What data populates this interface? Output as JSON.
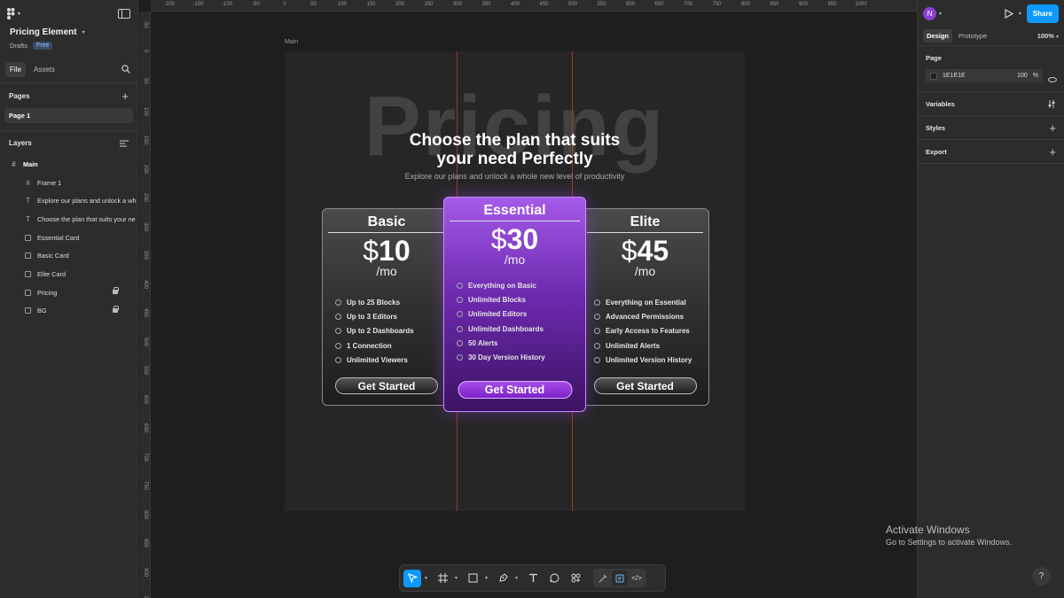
{
  "file": {
    "name": "Pricing Element",
    "location": "Drafts",
    "plan_badge": "Free"
  },
  "left_tabs": [
    "File",
    "Assets"
  ],
  "pages": {
    "title": "Pages",
    "items": [
      "Page 1"
    ]
  },
  "layers": {
    "title": "Layers",
    "items": [
      {
        "name": "Main",
        "icon": "frame-icon",
        "level": 0
      },
      {
        "name": "Frame 1",
        "icon": "frame-icon",
        "level": 1
      },
      {
        "name": "Explore our plans and unlock a wh",
        "icon": "text-icon",
        "level": 1
      },
      {
        "name": "Choose the plan that suits your ne",
        "icon": "text-icon",
        "level": 1
      },
      {
        "name": "Essential Card",
        "icon": "rect-icon",
        "level": 1
      },
      {
        "name": "Basic Card",
        "icon": "rect-icon",
        "level": 1
      },
      {
        "name": "Elite Card",
        "icon": "rect-icon",
        "level": 1
      },
      {
        "name": "Pricing",
        "icon": "rect-icon",
        "level": 1,
        "locked": true
      },
      {
        "name": "BG",
        "icon": "rect-icon",
        "level": 1,
        "locked": true
      }
    ]
  },
  "right_panel": {
    "avatar_initial": "N",
    "share_label": "Share",
    "tabs": [
      "Design",
      "Prototype"
    ],
    "zoom": "100%",
    "page_section": "Page",
    "page_color": "1E1E1E",
    "page_opacity": "100",
    "opacity_unit": "%",
    "sections": [
      "Variables",
      "Styles",
      "Export"
    ]
  },
  "rulers": {
    "h": [
      "-200",
      "-150",
      "-100",
      "-50",
      "0",
      "50",
      "100",
      "150",
      "200",
      "250",
      "300",
      "350",
      "400",
      "450",
      "500",
      "550",
      "600",
      "650",
      "700",
      "750",
      "800",
      "850",
      "900",
      "950",
      "1000"
    ],
    "v": [
      "-50",
      "0",
      "50",
      "100",
      "150",
      "200",
      "250",
      "300",
      "350",
      "400",
      "450",
      "500",
      "550",
      "600",
      "650",
      "700",
      "750",
      "800",
      "850",
      "900",
      "950"
    ]
  },
  "canvas": {
    "frame_label": "Main",
    "background_word": "Pricing",
    "headline_line1": "Choose the plan that suits",
    "headline_line2": "your need Perfectly",
    "subline": "Explore our plans and unlock a whole new level of productivity",
    "cards": [
      {
        "plan": "Basic",
        "currency": "$",
        "amount": "10",
        "period": "/mo",
        "features": [
          "Up to 25 Blocks",
          "Up to 3 Editors",
          "Up to 2 Dashboards",
          "1 Connection",
          "Unlimited Viewers"
        ],
        "cta": "Get Started"
      },
      {
        "plan": "Essential",
        "currency": "$",
        "amount": "30",
        "period": "/mo",
        "features": [
          "Everything on Basic",
          "Unlimited Blocks",
          "Unlimited Editors",
          "Unlimited Dashboards",
          "50 Alerts",
          "30 Day Version History"
        ],
        "cta": "Get Started"
      },
      {
        "plan": "Elite",
        "currency": "$",
        "amount": "45",
        "period": "/mo",
        "features": [
          "Everything on Essential",
          "Advanced Permissions",
          "Early Access to Features",
          "Unlimited Alerts",
          "Unlimited Version History"
        ],
        "cta": "Get Started"
      }
    ]
  },
  "activation": {
    "title": "Activate Windows",
    "subtitle": "Go to Settings to activate Windows."
  },
  "help_label": "?"
}
